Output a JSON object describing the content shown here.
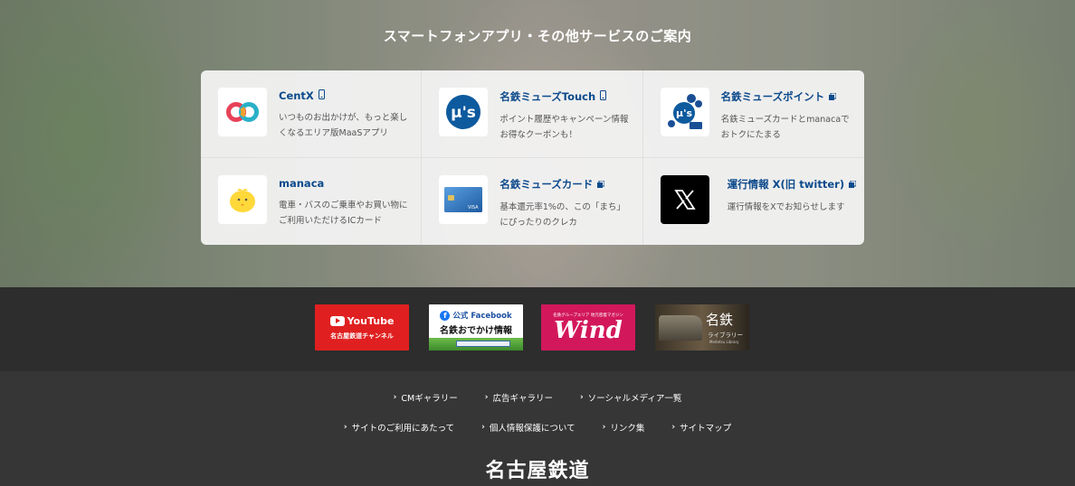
{
  "hero": {
    "title": "スマートフォンアプリ・その他サービスのご案内"
  },
  "services": [
    {
      "name": "CentX",
      "badge_icon": "smartphone-icon",
      "desc": "いつものお出かけが、もっと楽しくなるエリア版MaaSアプリ"
    },
    {
      "name": "名鉄ミューズTouch",
      "badge_icon": "smartphone-icon",
      "desc": "ポイント履歴やキャンペーン情報お得なクーポンも！"
    },
    {
      "name": "名鉄ミューズポイント",
      "badge_icon": "external-link-icon",
      "desc": "名鉄ミューズカードとmanacaでおトクにたまる"
    },
    {
      "name": "manaca",
      "badge_icon": "",
      "desc": "電車・バスのご乗車やお買い物にご利用いただけるICカード"
    },
    {
      "name": "名鉄ミューズカード",
      "badge_icon": "external-link-icon",
      "desc": "基本還元率1%の、この「まち」にぴったりのクレカ"
    },
    {
      "name": "運行情報 X(旧 twitter)",
      "badge_icon": "external-link-icon",
      "desc": "運行情報をXでお知らせします"
    }
  ],
  "banners": {
    "youtube": {
      "logo": "YouTube",
      "sub": "名古屋鉄道チャンネル"
    },
    "facebook": {
      "top": "公式 Facebook",
      "main": "名鉄おでかけ情報"
    },
    "wind": {
      "sub": "名鉄グループエリア 地元密着マガジン",
      "main": "Wind"
    },
    "library": {
      "title": "名鉄",
      "sub": "ライブラリー",
      "en": "Meitetsu Library"
    }
  },
  "footer": {
    "row1": [
      "CMギャラリー",
      "広告ギャラリー",
      "ソーシャルメディア一覧"
    ],
    "row2": [
      "サイトのご利用にあたって",
      "個人情報保護について",
      "リンク集",
      "サイトマップ"
    ],
    "logo": "名古屋鉄道"
  },
  "colors": {
    "accent": "#0c4a8c",
    "youtube": "#e02020",
    "wind": "#d2185a",
    "footer_bg": "#363636"
  }
}
